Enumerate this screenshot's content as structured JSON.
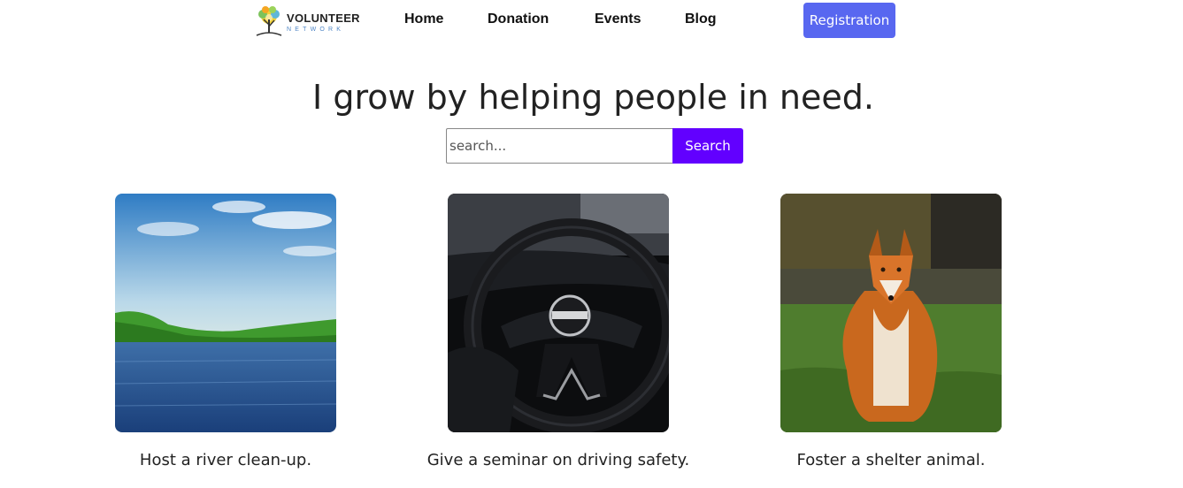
{
  "header": {
    "logo": {
      "title": "VOLUNTEER",
      "subtitle": "NETWORK"
    },
    "nav": [
      {
        "label": "Home"
      },
      {
        "label": "Donation"
      },
      {
        "label": "Events"
      },
      {
        "label": "Blog"
      }
    ],
    "registration_label": "Registration"
  },
  "hero": {
    "title": "I grow by helping people in need.",
    "search_placeholder": "search...",
    "search_button": "Search"
  },
  "cards": [
    {
      "title": "Host a river clean-up."
    },
    {
      "title": "Give a seminar on driving safety."
    },
    {
      "title": "Foster a shelter animal."
    }
  ],
  "colors": {
    "registration_button": "#5867f0",
    "search_button": "#6200ff",
    "logo_subtitle": "#4f86c6"
  }
}
